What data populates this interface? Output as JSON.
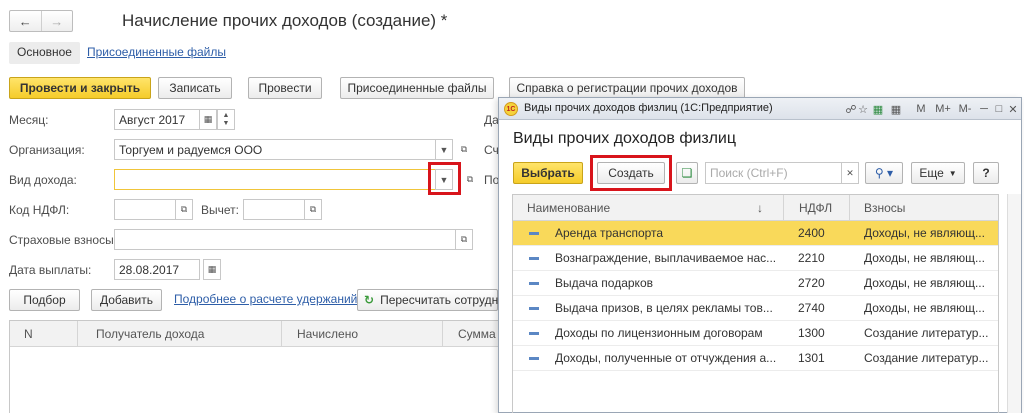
{
  "doc": {
    "title": "Начисление прочих доходов (создание) *",
    "tabs": [
      "Основное",
      "Присоединенные файлы"
    ]
  },
  "toolbar": {
    "post_close": "Провести и закрыть",
    "save": "Записать",
    "post": "Провести",
    "attached": "Присоединенные файлы",
    "reference": "Справка о регистрации прочих доходов"
  },
  "form": {
    "month_label": "Месяц:",
    "month_value": "Август 2017",
    "org_label": "Организация:",
    "org_value": "Торгуем и радуемся ООО",
    "income_type_label": "Вид дохода:",
    "income_type_value": "",
    "ndfl_code_label": "Код НДФЛ:",
    "deduction_label": "Вычет:",
    "insurance_label": "Страховые взносы:",
    "pay_date_label": "Дата выплаты:",
    "pay_date_value": "28.08.2017",
    "right_cut_1": "Да",
    "right_cut_2": "Сч",
    "right_cut_3": "По"
  },
  "actions": {
    "select": "Подбор",
    "add": "Добавить",
    "details_link": "Подробнее о расчете удержаний",
    "recalc": "Пересчитать сотрудн"
  },
  "grid": {
    "columns": [
      "N",
      "Получатель дохода",
      "Начислено",
      "Сумма"
    ]
  },
  "popup": {
    "window_title": "Виды прочих доходов физлиц  (1С:Предприятие)",
    "heading": "Виды прочих доходов физлиц",
    "select_button": "Выбрать",
    "create_button": "Создать",
    "search_placeholder": "Поиск (Ctrl+F)",
    "more_button": "Еще",
    "help_button": "?",
    "title_icons": [
      "M",
      "M+",
      "M-"
    ],
    "columns": [
      "Наименование",
      "НДФЛ",
      "Взносы"
    ],
    "rows": [
      {
        "name": "Аренда транспорта",
        "ndfl": "2400",
        "contrib": "Доходы, не являющ..."
      },
      {
        "name": "Вознаграждение, выплачиваемое нас...",
        "ndfl": "2210",
        "contrib": "Доходы, не являющ..."
      },
      {
        "name": "Выдача подарков",
        "ndfl": "2720",
        "contrib": "Доходы, не являющ..."
      },
      {
        "name": "Выдача призов, в целях рекламы тов...",
        "ndfl": "2740",
        "contrib": "Доходы, не являющ..."
      },
      {
        "name": "Доходы по лицензионным договорам",
        "ndfl": "1300",
        "contrib": "Создание литератур..."
      },
      {
        "name": "Доходы, полученные от отчуждения а...",
        "ndfl": "1301",
        "contrib": "Создание литератур..."
      }
    ]
  },
  "colors": {
    "accent_yellow": "#f5cc2a",
    "highlight_red": "#d8141b",
    "selected_row": "#f9d95a"
  }
}
